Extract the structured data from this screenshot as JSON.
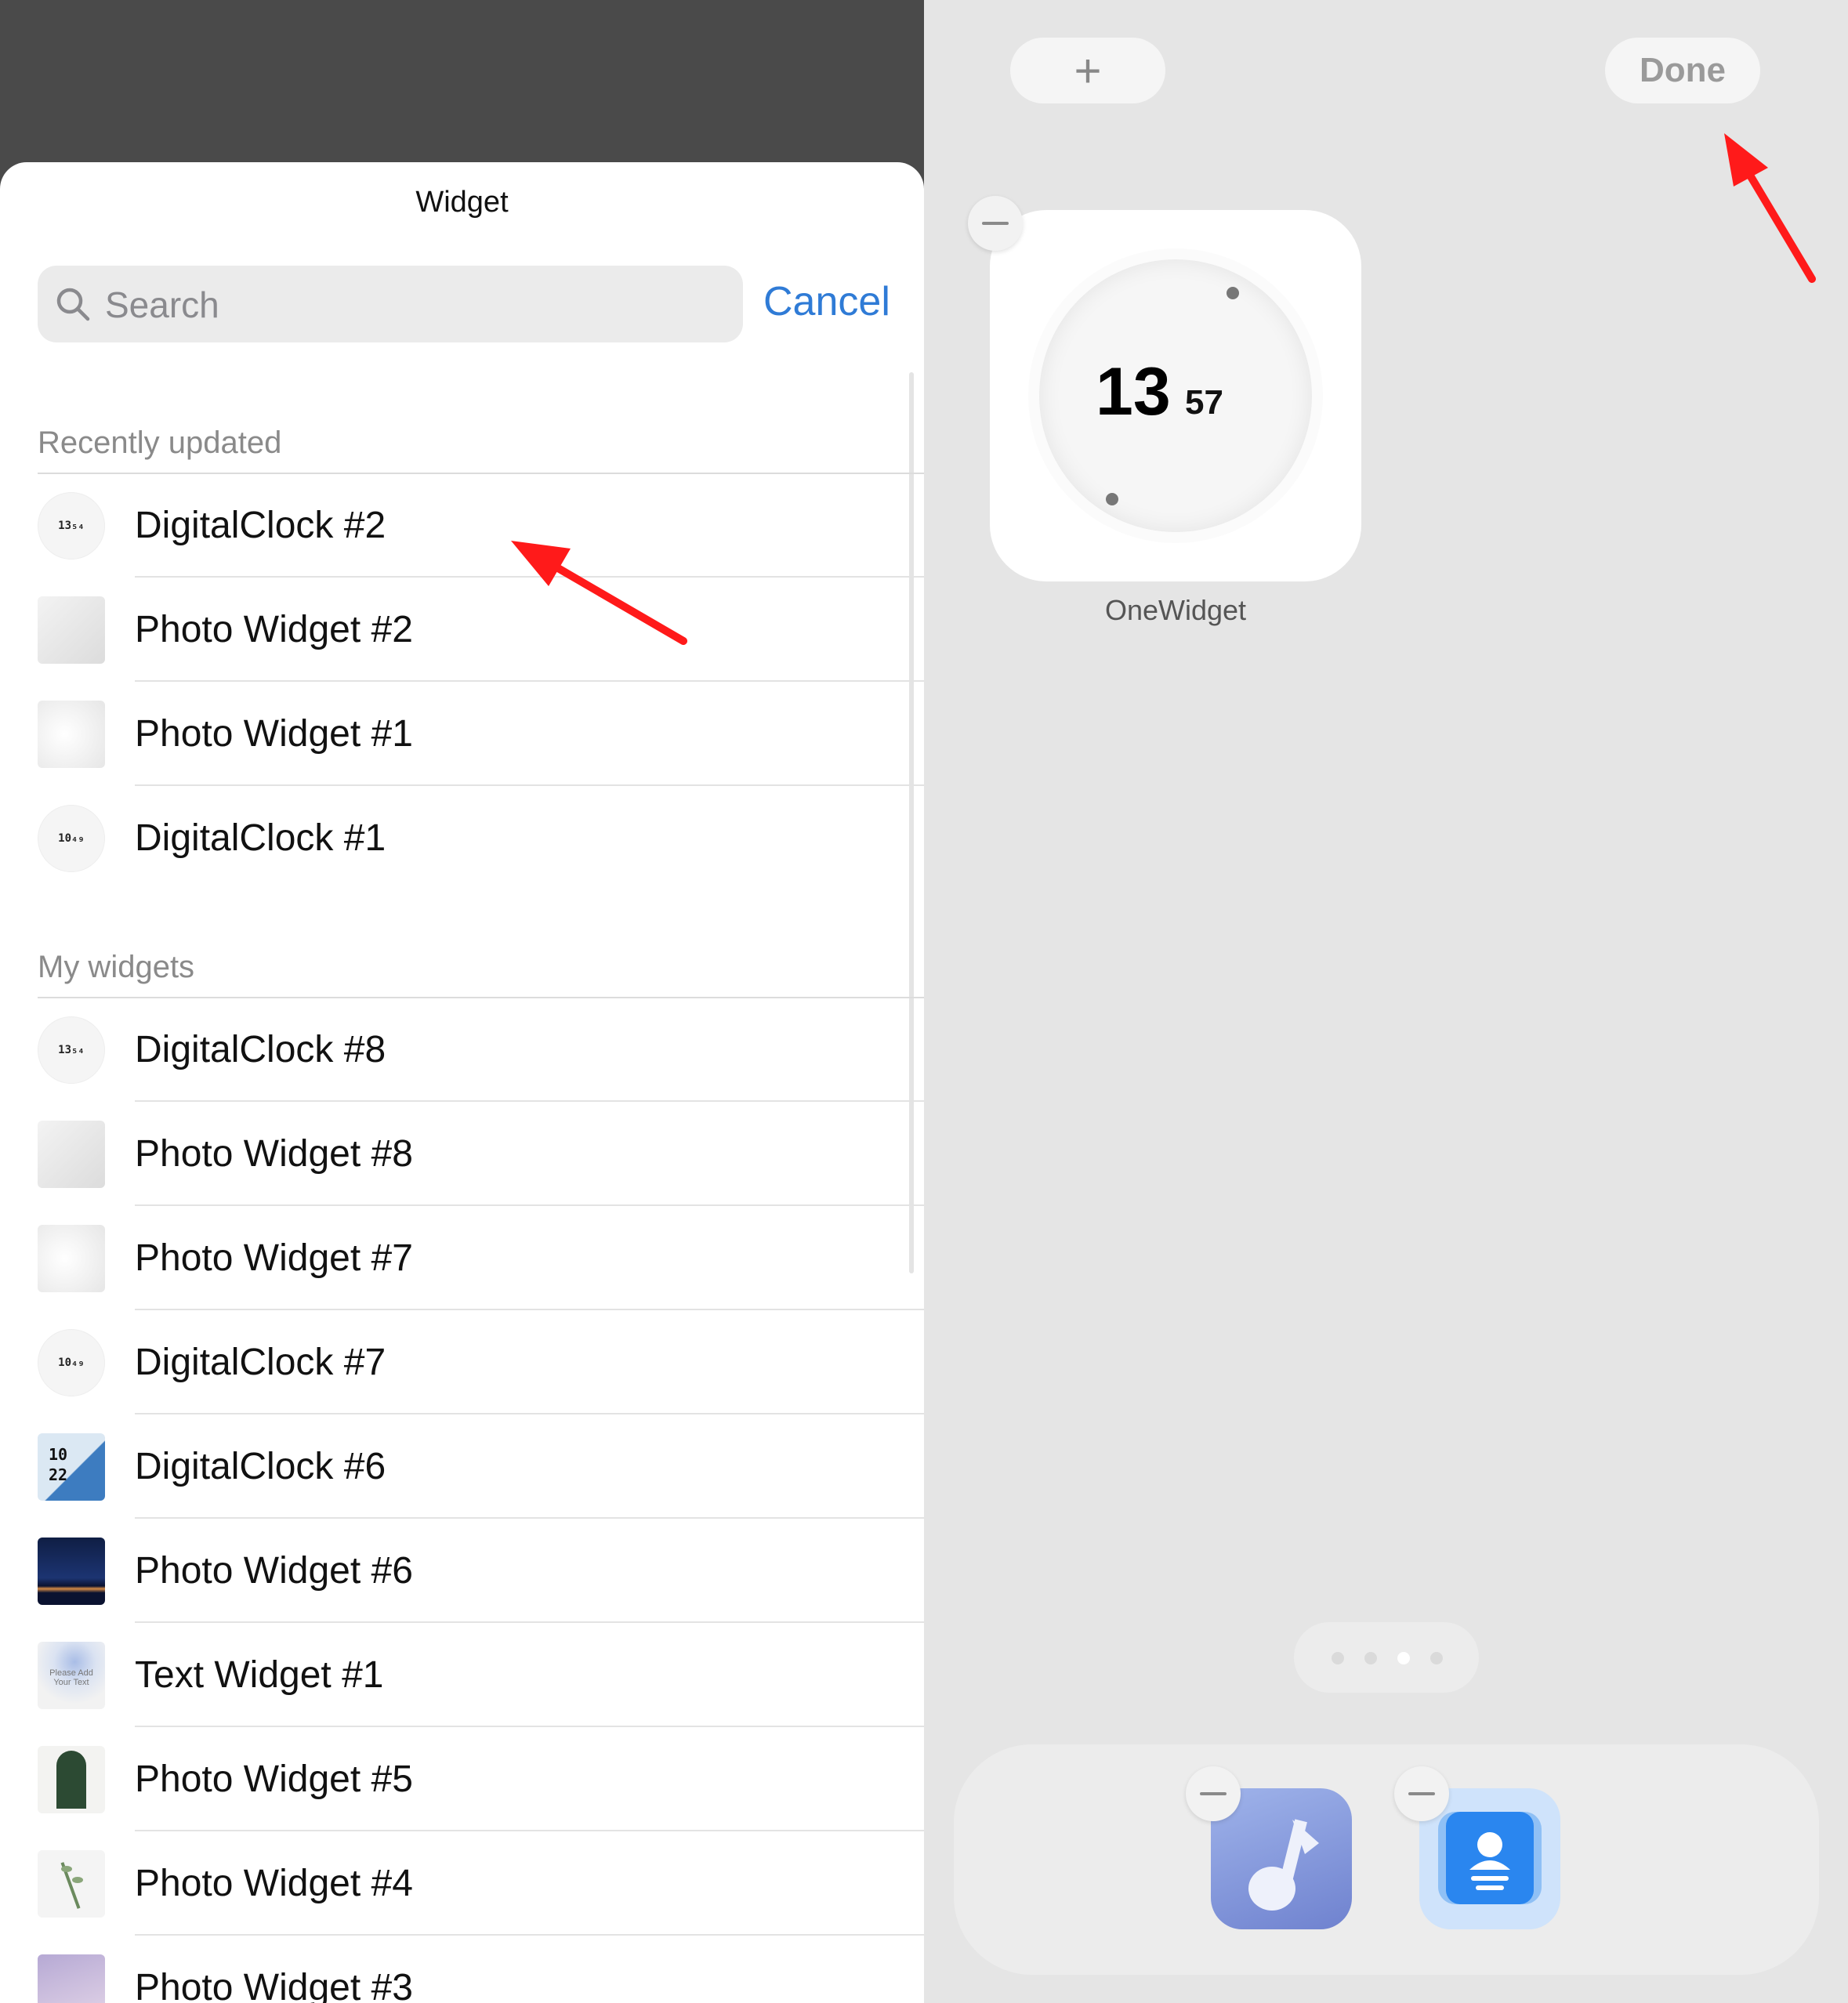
{
  "sheet": {
    "title": "Widget",
    "search": {
      "placeholder": "Search",
      "value": ""
    },
    "cancel_label": "Cancel"
  },
  "sections": {
    "recent": {
      "header": "Recently updated",
      "items": [
        {
          "label": "DigitalClock #2",
          "thumb": "clock",
          "thumb_text": "13₅₄"
        },
        {
          "label": "Photo Widget #2",
          "thumb": "photo-white-room"
        },
        {
          "label": "Photo Widget #1",
          "thumb": "photo-white-fabric"
        },
        {
          "label": "DigitalClock #1",
          "thumb": "clock",
          "thumb_text": "10₄₉"
        }
      ]
    },
    "mine": {
      "header": "My widgets",
      "items": [
        {
          "label": "DigitalClock #8",
          "thumb": "clock",
          "thumb_text": "13₅₄"
        },
        {
          "label": "Photo Widget #8",
          "thumb": "photo-white-room"
        },
        {
          "label": "Photo Widget #7",
          "thumb": "photo-white-fabric"
        },
        {
          "label": "DigitalClock #7",
          "thumb": "clock",
          "thumb_text": "10₄₉"
        },
        {
          "label": "DigitalClock #6",
          "thumb": "clock-blue",
          "thumb_text_top": "10",
          "thumb_text_bottom": "22"
        },
        {
          "label": "Photo Widget #6",
          "thumb": "photo-night-sea"
        },
        {
          "label": "Text Widget #1",
          "thumb": "text-flower",
          "thumb_text": "Please Add Your Text"
        },
        {
          "label": "Photo Widget #5",
          "thumb": "photo-door"
        },
        {
          "label": "Photo Widget #4",
          "thumb": "photo-plant"
        },
        {
          "label": "Photo Widget #3",
          "thumb": "photo-lilac"
        }
      ]
    }
  },
  "home": {
    "add_label": "+",
    "done_label": "Done",
    "widget": {
      "hour": "13",
      "minute": "57",
      "name": "OneWidget"
    },
    "page_indicator": {
      "count": 4,
      "active": 2
    },
    "dock_apps": [
      {
        "name": "music-app-icon"
      },
      {
        "name": "contacts-app-icon"
      }
    ]
  },
  "colors": {
    "accent": "#2f7bd6",
    "annotation_arrow": "#ff1a1a",
    "overlay": "#4a4a4a",
    "sheet": "#ffffff",
    "home_bg": "#e5e5e5"
  }
}
